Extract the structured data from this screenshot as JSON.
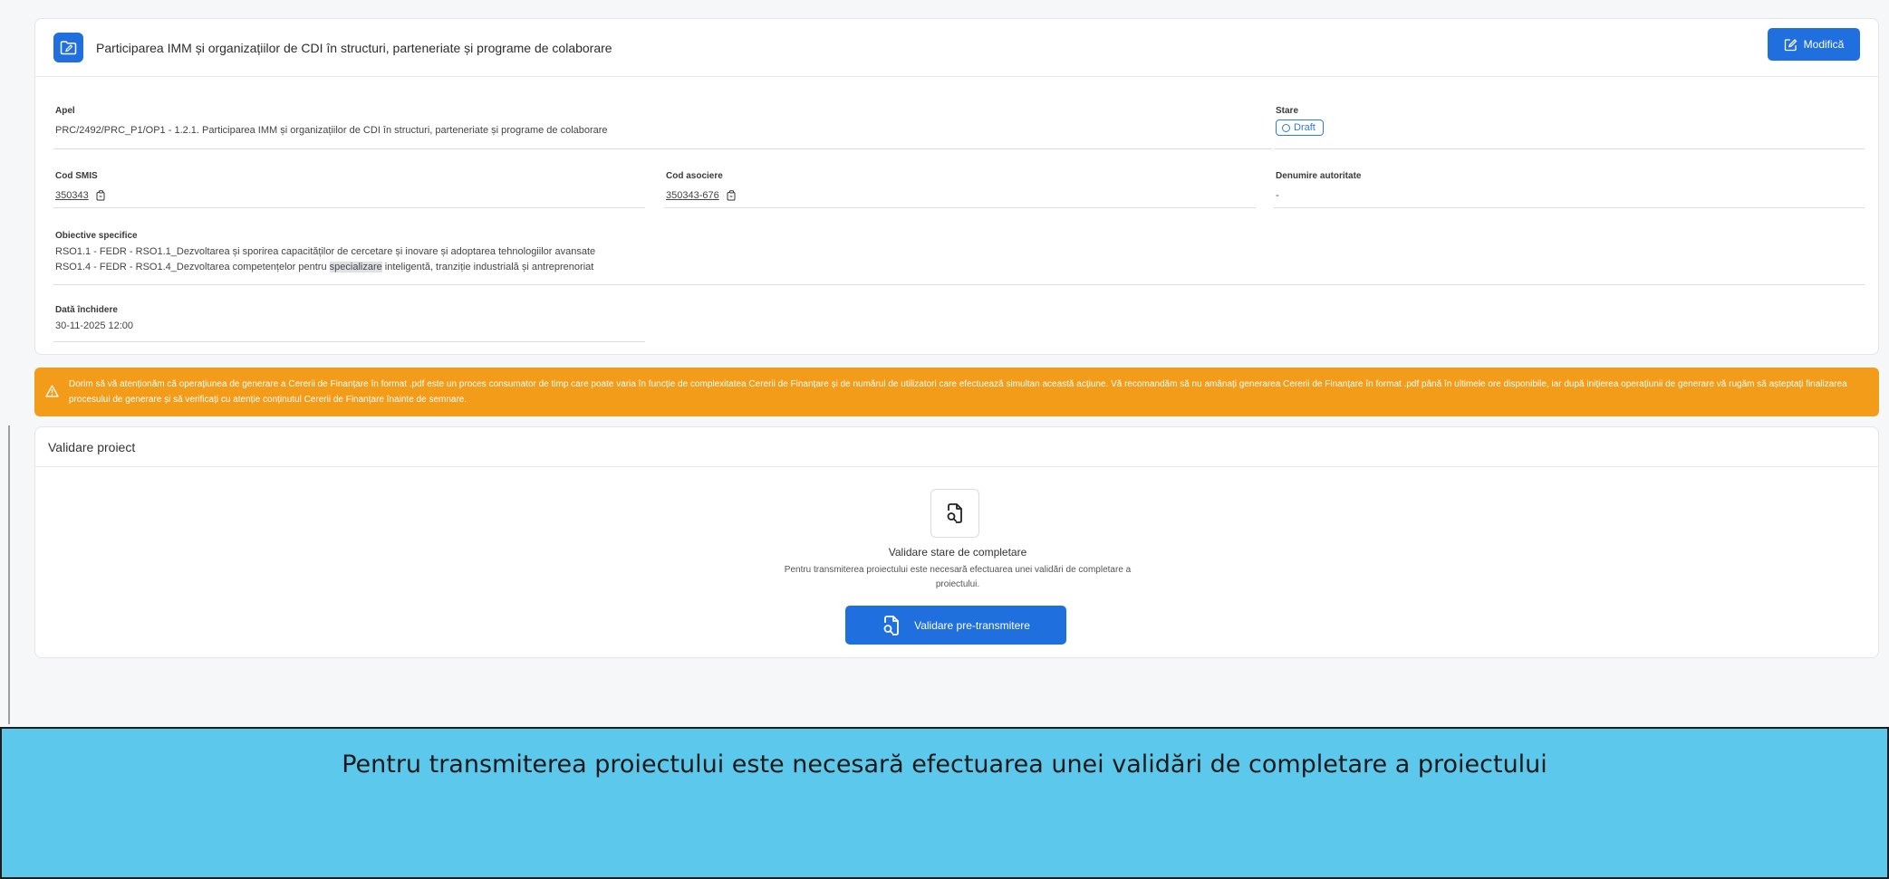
{
  "header": {
    "title": "Participarea IMM și organizațiilor de CDI în structuri, parteneriate și programe de colaborare",
    "edit_label": "Modifică"
  },
  "fields": {
    "apel": {
      "label": "Apel",
      "value": "PRC/2492/PRC_P1/OP1 - 1.2.1. Participarea IMM și organizațiilor de CDI în structuri, parteneriate și programe de colaborare"
    },
    "stare": {
      "label": "Stare",
      "value": "Draft"
    },
    "cod_smis": {
      "label": "Cod SMIS",
      "value": "350343"
    },
    "cod_asociere": {
      "label": "Cod asociere",
      "value": "350343-676"
    },
    "denumire_autoritate": {
      "label": "Denumire autoritate",
      "value": "-"
    },
    "obiective": {
      "label": "Obiective specifice",
      "line1": "RSO1.1 - FEDR - RSO1.1_Dezvoltarea și sporirea capacităților de cercetare și inovare și adoptarea tehnologiilor avansate",
      "line2_before": "RSO1.4 - FEDR - RSO1.4_Dezvoltarea competențelor pentru ",
      "line2_highlight": "specializare",
      "line2_after": " inteligentă, tranziție industrială și antreprenoriat"
    },
    "data_inchidere": {
      "label": "Dată închidere",
      "value": "30-11-2025 12:00"
    }
  },
  "warning": {
    "text": "Dorim să vă atenționăm că operațiunea de generare a Cererii de Finanțare în format .pdf este un proces consumator de timp care poate varia în funcție de complexitatea Cererii de Finanțare și de numărul de utilizatori care efectuează simultan această acțiune. Vă recomandăm să nu amânați generarea Cererii de Finanțare în format .pdf până în ultimele ore disponibile, iar după inițierea operațiunii de generare vă rugăm să așteptați finalizarea procesului de generare și să verificați cu atenție conținutul Cererii de Finanțare înainte de semnare."
  },
  "validation": {
    "header": "Validare proiect",
    "title": "Validare stare de completare",
    "description": "Pentru transmiterea proiectului este necesară efectuarea unei validări de completare a proiectului.",
    "button_label": "Validare pre-transmitere"
  },
  "caption": {
    "text": "Pentru transmiterea proiectului este necesară efectuarea unei validări de completare a proiectului"
  },
  "colors": {
    "primary": "#1f6fde",
    "warning": "#f39c19",
    "caption_bg": "#5bc8ec"
  },
  "icons": {
    "header": "folder-edit-icon",
    "edit": "pencil-square-icon",
    "copy": "copy-icon",
    "warning": "warning-triangle-icon",
    "validate": "file-search-icon"
  }
}
